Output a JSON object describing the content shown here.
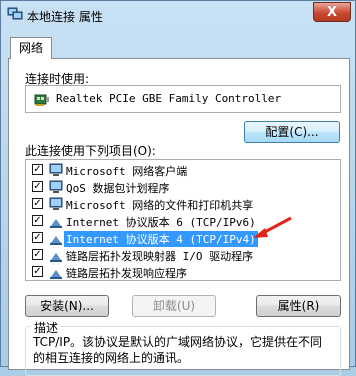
{
  "window": {
    "title": "本地连接 属性",
    "close_label": "X"
  },
  "tabs": [
    {
      "label": "网络"
    }
  ],
  "connect_using": {
    "label": "连接时使用:",
    "adapter": "Realtek PCIe GBE Family Controller",
    "configure_button": "配置(C)..."
  },
  "items_section": {
    "label": "此连接使用下列项目(O):",
    "items": [
      {
        "label": "Microsoft 网络客户端",
        "checked": true,
        "icon": "network-client-icon"
      },
      {
        "label": "QoS 数据包计划程序",
        "checked": true,
        "icon": "qos-scheduler-icon"
      },
      {
        "label": "Microsoft 网络的文件和打印机共享",
        "checked": true,
        "icon": "file-printer-sharing-icon"
      },
      {
        "label": "Internet 协议版本 6 (TCP/IPv6)",
        "checked": true,
        "icon": "protocol-icon"
      },
      {
        "label": "Internet 协议版本 4 (TCP/IPv4)",
        "checked": true,
        "icon": "protocol-icon",
        "selected": true
      },
      {
        "label": "链路层拓扑发现映射器 I/O 驱动程序",
        "checked": true,
        "icon": "protocol-icon"
      },
      {
        "label": "链路层拓扑发现响应程序",
        "checked": true,
        "icon": "protocol-icon"
      }
    ]
  },
  "buttons": {
    "install": "安装(N)...",
    "uninstall": "卸载(U)",
    "properties": "属性(R)"
  },
  "description": {
    "title": "描述",
    "text": "TCP/IP。该协议是默认的广域网络协议，它提供在不同的相互连接的网络上的通讯。"
  },
  "colors": {
    "selection": "#3399ff",
    "arrow": "#e2231a"
  }
}
